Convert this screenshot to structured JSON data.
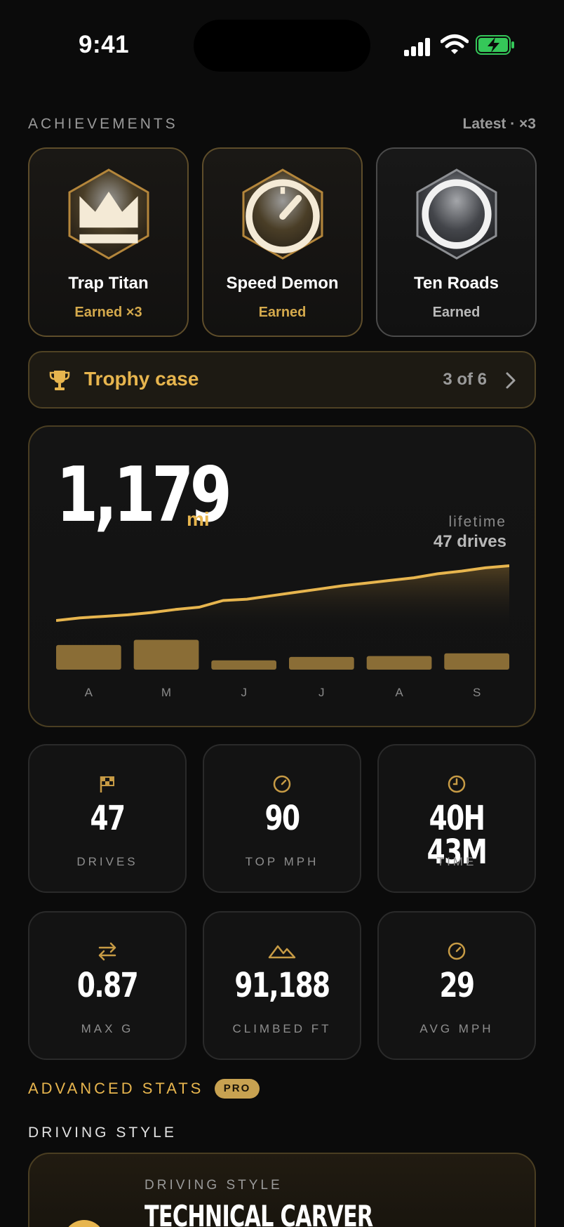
{
  "status_bar": {
    "time": "9:41"
  },
  "achievements": {
    "section_label": "ACHIEVEMENTS",
    "latest_label": "Latest · ×3",
    "items": [
      {
        "title": "Trap Titan",
        "status": "Earned ×3",
        "icon": "crown-icon",
        "tier": "gold"
      },
      {
        "title": "Speed Demon",
        "status": "Earned",
        "icon": "speedometer-icon",
        "tier": "gold"
      },
      {
        "title": "Ten Roads",
        "status": "Earned",
        "icon": "circle-icon",
        "tier": "silver"
      }
    ]
  },
  "trophy_case": {
    "label": "Trophy case",
    "count": "3 of 6",
    "icon": "trophy-icon"
  },
  "lifetime": {
    "miles": "1,179",
    "unit": "mi",
    "label": "lifetime",
    "drives": "47 drives"
  },
  "chart_data": {
    "type": "bar",
    "categories": [
      "A",
      "M",
      "J",
      "J",
      "A",
      "S"
    ],
    "series": [
      {
        "values": [
          190,
          230,
          72,
          98,
          105,
          126
        ]
      }
    ],
    "cumulative_line": [
      0,
      40,
      62,
      85,
      120,
      165,
      200,
      300,
      320,
      370,
      420,
      470,
      520,
      560,
      600,
      640,
      700,
      740,
      790,
      820
    ],
    "ylim": [
      0,
      260
    ],
    "colors": {
      "line": "#e7b54e",
      "bars": "#8a6d36"
    }
  },
  "stats_row1": [
    {
      "icon": "checkered-flag-icon",
      "value": "47",
      "label": "DRIVES"
    },
    {
      "icon": "speedometer-icon",
      "value": "90",
      "label": "TOP MPH"
    },
    {
      "icon": "clock-icon",
      "value": "40H 43M",
      "label": "TIME"
    }
  ],
  "stats_row2": [
    {
      "icon": "arrows-swap-icon",
      "value": "0.87",
      "label": "MAX G"
    },
    {
      "icon": "mountains-icon",
      "value": "91,188",
      "label": "CLIMBED FT"
    },
    {
      "icon": "speedometer-icon",
      "value": "29",
      "label": "AVG MPH"
    }
  ],
  "advanced": {
    "label": "ADVANCED STATS",
    "badge": "PRO"
  },
  "driving_style": {
    "header": "DRIVING STYLE",
    "kicker": "DRIVING STYLE",
    "title": "TECHNICAL CARVER"
  },
  "colors": {
    "accent": "#e7b54e",
    "background": "#0b0b0b"
  }
}
